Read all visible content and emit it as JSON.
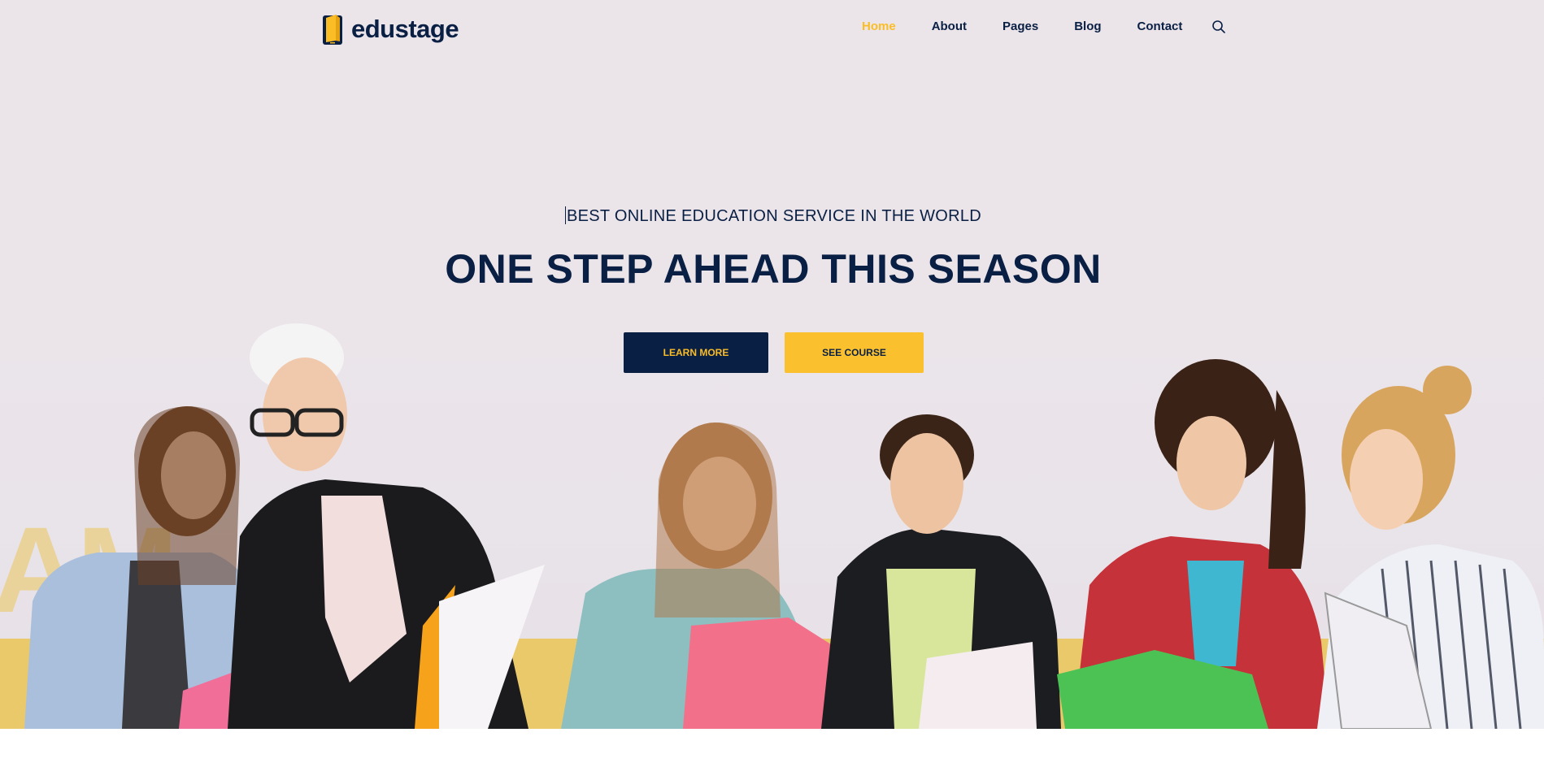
{
  "brand": {
    "name": "edustage",
    "logo_icon": "book-phone-logo-icon"
  },
  "nav": {
    "items": [
      {
        "label": "Home",
        "active": true
      },
      {
        "label": "About",
        "active": false
      },
      {
        "label": "Pages",
        "active": false
      },
      {
        "label": "Blog",
        "active": false
      },
      {
        "label": "Contact",
        "active": false
      }
    ],
    "search_icon": "search-icon"
  },
  "hero": {
    "eyebrow": "BEST ONLINE EDUCATION SERVICE IN THE WORLD",
    "headline": "ONE STEP AHEAD THIS SEASON",
    "buttons": {
      "learn_more": "LEARN MORE",
      "see_course": "SEE COURSE"
    },
    "image": "students-reading-notebooks-photo"
  },
  "colors": {
    "navy": "#0a1f44",
    "accent_yellow": "#fbbd26",
    "hero_background": "#ebe5ea"
  }
}
